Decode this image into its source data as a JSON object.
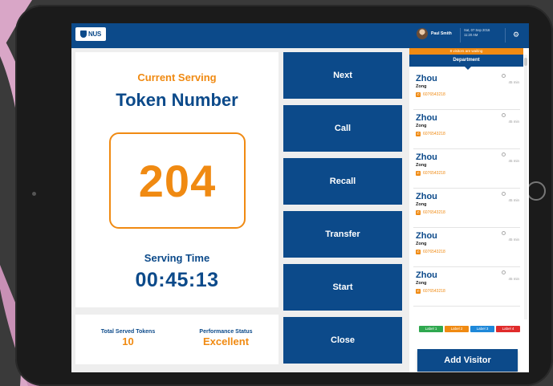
{
  "header": {
    "logo_text": "NUS",
    "user_name": "Paul Smith",
    "date": "Sat, 07 Sep 2016",
    "time": "11:20 AM"
  },
  "serving": {
    "heading": "Current Serving",
    "token_title": "Token Number",
    "token_number": "204",
    "time_label": "Serving Time",
    "time_value": "00:45:13"
  },
  "stats": {
    "total_label": "Total Served Tokens",
    "total_value": "10",
    "performance_label": "Performance Status",
    "performance_value": "Excellent"
  },
  "actions": [
    "Next",
    "Call",
    "Recall",
    "Transfer",
    "Start",
    "Close"
  ],
  "visitors_panel": {
    "waiting_text": "8 visitors are waiting",
    "department_label": "Department",
    "visitors": [
      {
        "first": "Zhou",
        "last": "Zong",
        "phone": "6076543218",
        "wait": "45 min"
      },
      {
        "first": "Zhou",
        "last": "Zong",
        "phone": "6076543218",
        "wait": "45 min"
      },
      {
        "first": "Zhou",
        "last": "Zong",
        "phone": "6076543218",
        "wait": "45 min"
      },
      {
        "first": "Zhou",
        "last": "Zong",
        "phone": "6076543218",
        "wait": "45 min"
      },
      {
        "first": "Zhou",
        "last": "Zong",
        "phone": "6076543218",
        "wait": "45 min"
      },
      {
        "first": "Zhou",
        "last": "Zong",
        "phone": "6076543218",
        "wait": "45 min"
      }
    ],
    "labels": [
      {
        "text": "Label 1",
        "color": "#2fa84f"
      },
      {
        "text": "Label 2",
        "color": "#f08a12"
      },
      {
        "text": "Label 3",
        "color": "#1e88d9"
      },
      {
        "text": "Label 4",
        "color": "#e02b2b"
      }
    ],
    "add_button": "Add Visitor"
  },
  "colors": {
    "primary": "#0c4a8a",
    "accent": "#f08a12",
    "background_swoosh": "#d9a6c7"
  }
}
